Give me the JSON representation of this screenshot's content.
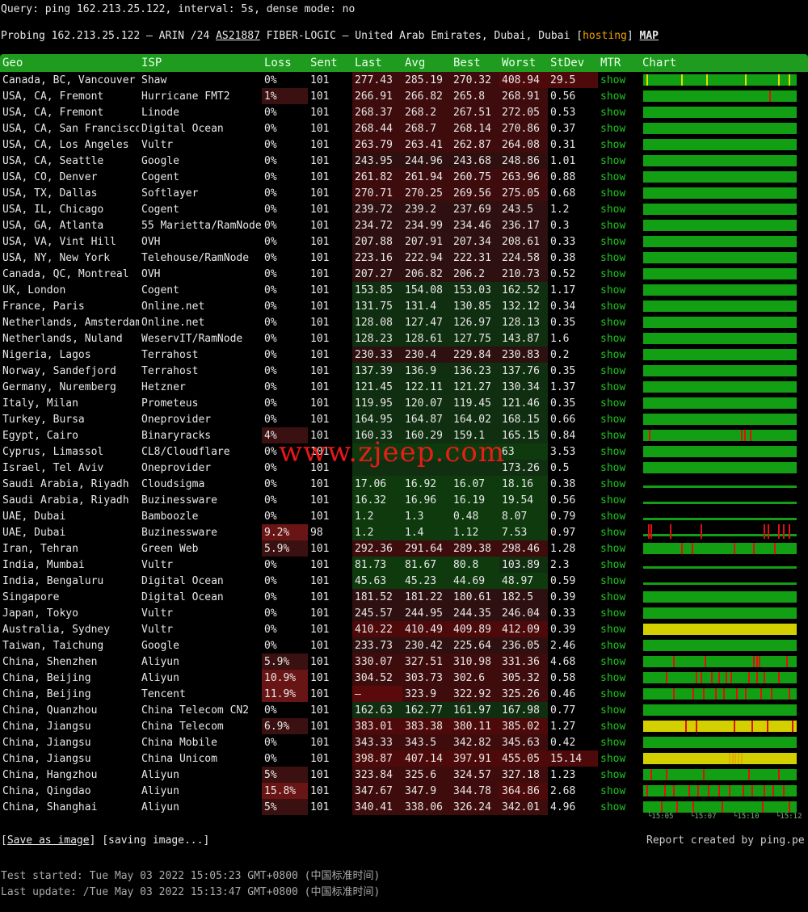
{
  "header": {
    "query": "Query: ping 162.213.25.122, interval: 5s, dense mode: no",
    "probe_prefix": "Probing 162.213.25.122 — ARIN /24 ",
    "probe_as": "AS21887",
    "probe_mid": " FIBER-LOGIC — United Arab Emirates, Dubai, Dubai [",
    "probe_hosting": "hosting",
    "probe_close": "] ",
    "probe_map": "MAP"
  },
  "columns": [
    "Geo",
    "ISP",
    "Loss",
    "Sent",
    "Last",
    "Avg",
    "Best",
    "Worst",
    "StDev",
    "MTR",
    "Chart"
  ],
  "colors": {
    "green_bar": "#139f13",
    "yellow_bar": "#d4d000",
    "spike_red": "#e01010",
    "show": "#1fc71f",
    "header_bg": "#1f9c1f"
  },
  "rows": [
    {
      "geo": "Canada, BC, Vancouver",
      "isp": "Shaw",
      "loss": "0%",
      "sent": "101",
      "last": "277.43",
      "avg": "285.19",
      "best": "270.32",
      "worst": "408.94",
      "stdev": "29.5",
      "mtr": "show",
      "spikes": [
        {
          "p": 0.25,
          "c": "#e0e000"
        },
        {
          "p": 0.42,
          "c": "#e0e000"
        },
        {
          "p": 0.68,
          "c": "#e0e000"
        },
        {
          "p": 0.97,
          "c": "#e0e000"
        },
        {
          "p": 0.02,
          "c": "#e0e000"
        },
        {
          "p": 0.9,
          "c": "#e0e000"
        }
      ]
    },
    {
      "geo": "USA, CA, Fremont",
      "isp": "Hurricane FMT2",
      "loss": "1%",
      "sent": "101",
      "last": "266.91",
      "avg": "266.82",
      "best": "265.8",
      "worst": "268.91",
      "stdev": "0.56",
      "mtr": "show",
      "spikes": [
        {
          "p": 0.84,
          "c": "#e01010"
        }
      ]
    },
    {
      "geo": "USA, CA, Fremont",
      "isp": "Linode",
      "loss": "0%",
      "sent": "101",
      "last": "268.37",
      "avg": "268.2",
      "best": "267.51",
      "worst": "272.05",
      "stdev": "0.53",
      "mtr": "show"
    },
    {
      "geo": "USA, CA, San Francisco",
      "isp": "Digital Ocean",
      "loss": "0%",
      "sent": "101",
      "last": "268.44",
      "avg": "268.7",
      "best": "268.14",
      "worst": "270.86",
      "stdev": "0.37",
      "mtr": "show"
    },
    {
      "geo": "USA, CA, Los Angeles",
      "isp": "Vultr",
      "loss": "0%",
      "sent": "101",
      "last": "263.79",
      "avg": "263.41",
      "best": "262.87",
      "worst": "264.08",
      "stdev": "0.31",
      "mtr": "show"
    },
    {
      "geo": "USA, CA, Seattle",
      "isp": "Google",
      "loss": "0%",
      "sent": "101",
      "last": "243.95",
      "avg": "244.96",
      "best": "243.68",
      "worst": "248.86",
      "stdev": "1.01",
      "mtr": "show"
    },
    {
      "geo": "USA, CO, Denver",
      "isp": "Cogent",
      "loss": "0%",
      "sent": "101",
      "last": "261.82",
      "avg": "261.94",
      "best": "260.75",
      "worst": "263.96",
      "stdev": "0.88",
      "mtr": "show"
    },
    {
      "geo": "USA, TX, Dallas",
      "isp": "Softlayer",
      "loss": "0%",
      "sent": "101",
      "last": "270.71",
      "avg": "270.25",
      "best": "269.56",
      "worst": "275.05",
      "stdev": "0.68",
      "mtr": "show"
    },
    {
      "geo": "USA, IL, Chicago",
      "isp": "Cogent",
      "loss": "0%",
      "sent": "101",
      "last": "239.72",
      "avg": "239.2",
      "best": "237.69",
      "worst": "243.5",
      "stdev": "1.2",
      "mtr": "show"
    },
    {
      "geo": "USA, GA, Atlanta",
      "isp": "55 Marietta/RamNode",
      "loss": "0%",
      "sent": "101",
      "last": "234.72",
      "avg": "234.99",
      "best": "234.46",
      "worst": "236.17",
      "stdev": "0.3",
      "mtr": "show"
    },
    {
      "geo": "USA, VA, Vint Hill",
      "isp": "OVH",
      "loss": "0%",
      "sent": "101",
      "last": "207.88",
      "avg": "207.91",
      "best": "207.34",
      "worst": "208.61",
      "stdev": "0.33",
      "mtr": "show"
    },
    {
      "geo": "USA, NY, New York",
      "isp": "Telehouse/RamNode",
      "loss": "0%",
      "sent": "101",
      "last": "223.16",
      "avg": "222.94",
      "best": "222.31",
      "worst": "224.58",
      "stdev": "0.38",
      "mtr": "show"
    },
    {
      "geo": "Canada, QC, Montreal",
      "isp": "OVH",
      "loss": "0%",
      "sent": "101",
      "last": "207.27",
      "avg": "206.82",
      "best": "206.2",
      "worst": "210.73",
      "stdev": "0.52",
      "mtr": "show"
    },
    {
      "geo": "UK, London",
      "isp": "Cogent",
      "loss": "0%",
      "sent": "101",
      "last": "153.85",
      "avg": "154.08",
      "best": "153.03",
      "worst": "162.52",
      "stdev": "1.17",
      "mtr": "show"
    },
    {
      "geo": "France, Paris",
      "isp": "Online.net",
      "loss": "0%",
      "sent": "101",
      "last": "131.75",
      "avg": "131.4",
      "best": "130.85",
      "worst": "132.12",
      "stdev": "0.34",
      "mtr": "show"
    },
    {
      "geo": "Netherlands, Amsterdam",
      "isp": "Online.net",
      "loss": "0%",
      "sent": "101",
      "last": "128.08",
      "avg": "127.47",
      "best": "126.97",
      "worst": "128.13",
      "stdev": "0.35",
      "mtr": "show"
    },
    {
      "geo": "Netherlands, Nuland",
      "isp": "WeservIT/RamNode",
      "loss": "0%",
      "sent": "101",
      "last": "128.23",
      "avg": "128.61",
      "best": "127.75",
      "worst": "143.87",
      "stdev": "1.6",
      "mtr": "show"
    },
    {
      "geo": "Nigeria, Lagos",
      "isp": "Terrahost",
      "loss": "0%",
      "sent": "101",
      "last": "230.33",
      "avg": "230.4",
      "best": "229.84",
      "worst": "230.83",
      "stdev": "0.2",
      "mtr": "show"
    },
    {
      "geo": "Norway, Sandefjord",
      "isp": "Terrahost",
      "loss": "0%",
      "sent": "101",
      "last": "137.39",
      "avg": "136.9",
      "best": "136.23",
      "worst": "137.76",
      "stdev": "0.35",
      "mtr": "show"
    },
    {
      "geo": "Germany, Nuremberg",
      "isp": "Hetzner",
      "loss": "0%",
      "sent": "101",
      "last": "121.45",
      "avg": "122.11",
      "best": "121.27",
      "worst": "130.34",
      "stdev": "1.37",
      "mtr": "show"
    },
    {
      "geo": "Italy, Milan",
      "isp": "Prometeus",
      "loss": "0%",
      "sent": "101",
      "last": "119.95",
      "avg": "120.07",
      "best": "119.45",
      "worst": "121.46",
      "stdev": "0.35",
      "mtr": "show"
    },
    {
      "geo": "Turkey, Bursa",
      "isp": "Oneprovider",
      "loss": "0%",
      "sent": "101",
      "last": "164.95",
      "avg": "164.87",
      "best": "164.02",
      "worst": "168.15",
      "stdev": "0.66",
      "mtr": "show"
    },
    {
      "geo": "Egypt, Cairo",
      "isp": "Binaryracks",
      "loss": "4%",
      "sent": "101",
      "last": "160.33",
      "avg": "160.29",
      "best": "159.1",
      "worst": "165.15",
      "stdev": "0.84",
      "mtr": "show",
      "spikes": [
        {
          "p": 0.04,
          "c": "#e01010"
        },
        {
          "p": 0.65,
          "c": "#e01010"
        },
        {
          "p": 0.67,
          "c": "#e01010"
        },
        {
          "p": 0.71,
          "c": "#e01010"
        }
      ]
    },
    {
      "geo": "Cyprus, Limassol",
      "isp": "CL8/Cloudflare",
      "loss": "0%",
      "sent": "101",
      "last": "",
      "avg": "",
      "best": "",
      "worst": "63",
      "stdev": "3.53",
      "mtr": "show"
    },
    {
      "geo": "Israel, Tel Aviv",
      "isp": "Oneprovider",
      "loss": "0%",
      "sent": "101",
      "last": "",
      "avg": "",
      "best": "",
      "worst": "173.26",
      "stdev": "0.5",
      "mtr": "show"
    },
    {
      "geo": "Saudi Arabia, Riyadh",
      "isp": "Cloudsigma",
      "loss": "0%",
      "sent": "101",
      "last": "17.06",
      "avg": "16.92",
      "best": "16.07",
      "worst": "18.16",
      "stdev": "0.38",
      "mtr": "show",
      "flat": true
    },
    {
      "geo": "Saudi Arabia, Riyadh",
      "isp": "Buzinessware",
      "loss": "0%",
      "sent": "101",
      "last": "16.32",
      "avg": "16.96",
      "best": "16.19",
      "worst": "19.54",
      "stdev": "0.56",
      "mtr": "show",
      "flat": true
    },
    {
      "geo": "UAE, Dubai",
      "isp": "Bamboozle",
      "loss": "0%",
      "sent": "101",
      "last": "1.2",
      "avg": "1.3",
      "best": "0.48",
      "worst": "8.07",
      "stdev": "0.79",
      "mtr": "show",
      "flat": true
    },
    {
      "geo": "UAE, Dubai",
      "isp": "Buzinessware",
      "loss": "9.2%",
      "sent": "98",
      "last": "1.2",
      "avg": "1.4",
      "best": "1.12",
      "worst": "7.53",
      "stdev": "0.97",
      "mtr": "show",
      "flat": true,
      "spikes": [
        {
          "p": 0.03,
          "c": "#e01010"
        },
        {
          "p": 0.05,
          "c": "#e01010"
        },
        {
          "p": 0.18,
          "c": "#e01010"
        },
        {
          "p": 0.38,
          "c": "#e01010"
        },
        {
          "p": 0.8,
          "c": "#e01010"
        },
        {
          "p": 0.83,
          "c": "#e01010"
        },
        {
          "p": 0.9,
          "c": "#e01010"
        },
        {
          "p": 0.93,
          "c": "#e01010"
        },
        {
          "p": 0.97,
          "c": "#e01010"
        }
      ]
    },
    {
      "geo": "Iran, Tehran",
      "isp": "Green Web",
      "loss": "5.9%",
      "sent": "101",
      "last": "292.36",
      "avg": "291.64",
      "best": "289.38",
      "worst": "298.46",
      "stdev": "1.28",
      "mtr": "show",
      "spikes": [
        {
          "p": 0.25,
          "c": "#e01010"
        },
        {
          "p": 0.32,
          "c": "#e01010"
        },
        {
          "p": 0.6,
          "c": "#e01010"
        },
        {
          "p": 0.73,
          "c": "#e01010"
        },
        {
          "p": 0.87,
          "c": "#e01010"
        }
      ]
    },
    {
      "geo": "India, Mumbai",
      "isp": "Vultr",
      "loss": "0%",
      "sent": "101",
      "last": "81.73",
      "avg": "81.67",
      "best": "80.8",
      "worst": "103.89",
      "stdev": "2.3",
      "mtr": "show",
      "flat": true
    },
    {
      "geo": "India, Bengaluru",
      "isp": "Digital Ocean",
      "loss": "0%",
      "sent": "101",
      "last": "45.63",
      "avg": "45.23",
      "best": "44.69",
      "worst": "48.97",
      "stdev": "0.59",
      "mtr": "show",
      "flat": true
    },
    {
      "geo": "Singapore",
      "isp": "Digital Ocean",
      "loss": "0%",
      "sent": "101",
      "last": "181.52",
      "avg": "181.22",
      "best": "180.61",
      "worst": "182.5",
      "stdev": "0.39",
      "mtr": "show"
    },
    {
      "geo": "Japan, Tokyo",
      "isp": "Vultr",
      "loss": "0%",
      "sent": "101",
      "last": "245.57",
      "avg": "244.95",
      "best": "244.35",
      "worst": "246.04",
      "stdev": "0.33",
      "mtr": "show"
    },
    {
      "geo": "Australia, Sydney",
      "isp": "Vultr",
      "loss": "0%",
      "sent": "101",
      "last": "410.22",
      "avg": "410.49",
      "best": "409.89",
      "worst": "412.09",
      "stdev": "0.39",
      "mtr": "show",
      "yellow": true
    },
    {
      "geo": "Taiwan, Taichung",
      "isp": "Google",
      "loss": "0%",
      "sent": "101",
      "last": "233.73",
      "avg": "230.42",
      "best": "225.64",
      "worst": "236.05",
      "stdev": "2.46",
      "mtr": "show"
    },
    {
      "geo": "China, Shenzhen",
      "isp": "Aliyun",
      "loss": "5.9%",
      "sent": "101",
      "last": "330.07",
      "avg": "327.51",
      "best": "310.98",
      "worst": "331.36",
      "stdev": "4.68",
      "mtr": "show",
      "spikes": [
        {
          "p": 0.2,
          "c": "#e01010"
        },
        {
          "p": 0.41,
          "c": "#e01010"
        },
        {
          "p": 0.73,
          "c": "#e01010"
        },
        {
          "p": 0.75,
          "c": "#e01010"
        },
        {
          "p": 0.77,
          "c": "#e01010"
        },
        {
          "p": 0.95,
          "c": "#e01010"
        }
      ]
    },
    {
      "geo": "China, Beijing",
      "isp": "Aliyun",
      "loss": "10.9%",
      "sent": "101",
      "last": "304.52",
      "avg": "303.73",
      "best": "302.6",
      "worst": "305.32",
      "stdev": "0.58",
      "mtr": "show",
      "spikes": [
        {
          "p": 0.15,
          "c": "#e01010"
        },
        {
          "p": 0.35,
          "c": "#e01010"
        },
        {
          "p": 0.38,
          "c": "#e01010"
        },
        {
          "p": 0.45,
          "c": "#e01010"
        },
        {
          "p": 0.5,
          "c": "#e01010"
        },
        {
          "p": 0.55,
          "c": "#e01010"
        },
        {
          "p": 0.58,
          "c": "#e01010"
        },
        {
          "p": 0.7,
          "c": "#e01010"
        },
        {
          "p": 0.75,
          "c": "#e01010"
        },
        {
          "p": 0.8,
          "c": "#e01010"
        },
        {
          "p": 0.9,
          "c": "#e01010"
        }
      ]
    },
    {
      "geo": "China, Beijing",
      "isp": "Tencent",
      "loss": "11.9%",
      "sent": "101",
      "last": "—",
      "avg": "323.9",
      "best": "322.92",
      "worst": "325.26",
      "stdev": "0.46",
      "mtr": "show",
      "spikes": [
        {
          "p": 0.2,
          "c": "#e01010"
        },
        {
          "p": 0.33,
          "c": "#e01010"
        },
        {
          "p": 0.4,
          "c": "#e01010"
        },
        {
          "p": 0.48,
          "c": "#e01010"
        },
        {
          "p": 0.53,
          "c": "#e01010"
        },
        {
          "p": 0.62,
          "c": "#e01010"
        },
        {
          "p": 0.68,
          "c": "#e01010"
        },
        {
          "p": 0.78,
          "c": "#e01010"
        },
        {
          "p": 0.85,
          "c": "#e01010"
        },
        {
          "p": 0.97,
          "c": "#e01010"
        }
      ]
    },
    {
      "geo": "China, Quanzhou",
      "isp": "China Telecom CN2",
      "loss": "0%",
      "sent": "101",
      "last": "162.63",
      "avg": "162.77",
      "best": "161.97",
      "worst": "167.98",
      "stdev": "0.77",
      "mtr": "show"
    },
    {
      "geo": "China, Jiangsu",
      "isp": "China Telecom",
      "loss": "6.9%",
      "sent": "101",
      "last": "383.01",
      "avg": "383.38",
      "best": "380.11",
      "worst": "385.02",
      "stdev": "1.27",
      "mtr": "show",
      "yellow": true,
      "spikes": [
        {
          "p": 0.28,
          "c": "#e01010"
        },
        {
          "p": 0.35,
          "c": "#e01010"
        },
        {
          "p": 0.6,
          "c": "#e01010"
        },
        {
          "p": 0.72,
          "c": "#e01010"
        },
        {
          "p": 0.82,
          "c": "#e01010"
        },
        {
          "p": 0.99,
          "c": "#e01010"
        }
      ]
    },
    {
      "geo": "China, Jiangsu",
      "isp": "China Mobile",
      "loss": "0%",
      "sent": "101",
      "last": "343.33",
      "avg": "343.5",
      "best": "342.82",
      "worst": "345.63",
      "stdev": "0.42",
      "mtr": "show"
    },
    {
      "geo": "China, Jiangsu",
      "isp": "China Unicom",
      "loss": "0%",
      "sent": "101",
      "last": "398.87",
      "avg": "407.14",
      "best": "397.91",
      "worst": "455.05",
      "stdev": "15.14",
      "mtr": "show",
      "yellow": true,
      "spikes": [
        {
          "p": 0.57,
          "c": "#e0b000"
        },
        {
          "p": 0.59,
          "c": "#e0b000"
        },
        {
          "p": 0.61,
          "c": "#e0b000"
        },
        {
          "p": 0.63,
          "c": "#e0b000"
        },
        {
          "p": 0.65,
          "c": "#e0b000"
        }
      ]
    },
    {
      "geo": "China, Hangzhou",
      "isp": "Aliyun",
      "loss": "5%",
      "sent": "101",
      "last": "323.84",
      "avg": "325.6",
      "best": "324.57",
      "worst": "327.18",
      "stdev": "1.23",
      "mtr": "show",
      "spikes": [
        {
          "p": 0.05,
          "c": "#e01010"
        },
        {
          "p": 0.15,
          "c": "#e01010"
        },
        {
          "p": 0.4,
          "c": "#e01010"
        },
        {
          "p": 0.7,
          "c": "#e01010"
        },
        {
          "p": 0.9,
          "c": "#e01010"
        }
      ]
    },
    {
      "geo": "China, Qingdao",
      "isp": "Aliyun",
      "loss": "15.8%",
      "sent": "101",
      "last": "347.67",
      "avg": "347.9",
      "best": "344.78",
      "worst": "364.86",
      "stdev": "2.68",
      "mtr": "show",
      "spikes": [
        {
          "p": 0.02,
          "c": "#e01010"
        },
        {
          "p": 0.14,
          "c": "#e01010"
        },
        {
          "p": 0.2,
          "c": "#e01010"
        },
        {
          "p": 0.3,
          "c": "#e01010"
        },
        {
          "p": 0.36,
          "c": "#e01010"
        },
        {
          "p": 0.43,
          "c": "#e01010"
        },
        {
          "p": 0.5,
          "c": "#e01010"
        },
        {
          "p": 0.57,
          "c": "#e01010"
        },
        {
          "p": 0.66,
          "c": "#e01010"
        },
        {
          "p": 0.72,
          "c": "#e01010"
        },
        {
          "p": 0.8,
          "c": "#e01010"
        },
        {
          "p": 0.86,
          "c": "#e01010"
        },
        {
          "p": 0.93,
          "c": "#e01010"
        }
      ]
    },
    {
      "geo": "China, Shanghai",
      "isp": "Aliyun",
      "loss": "5%",
      "sent": "101",
      "last": "340.41",
      "avg": "338.06",
      "best": "326.24",
      "worst": "342.01",
      "stdev": "4.96",
      "mtr": "show",
      "spikes": [
        {
          "p": 0.12,
          "c": "#e01010"
        },
        {
          "p": 0.22,
          "c": "#e01010"
        },
        {
          "p": 0.33,
          "c": "#e01010"
        },
        {
          "p": 0.52,
          "c": "#e01010"
        },
        {
          "p": 0.79,
          "c": "#e01010"
        },
        {
          "p": 0.97,
          "c": "#e01010"
        }
      ]
    }
  ],
  "time_ticks": [
    "└15:05",
    "└15:07",
    "└15:10",
    "└15:12"
  ],
  "footer": {
    "save_label": "Save as image",
    "save_open": "[",
    "save_close": "] [saving image...]",
    "report": "Report created by ping.pe",
    "started": "Test started: Tue May 03 2022 15:05:23 GMT+0800 (中国标准时间)",
    "updated": "Last update: /Tue May 03 2022 15:13:47 GMT+0800 (中国标准时间)"
  },
  "watermark": "www.zjeep.com"
}
